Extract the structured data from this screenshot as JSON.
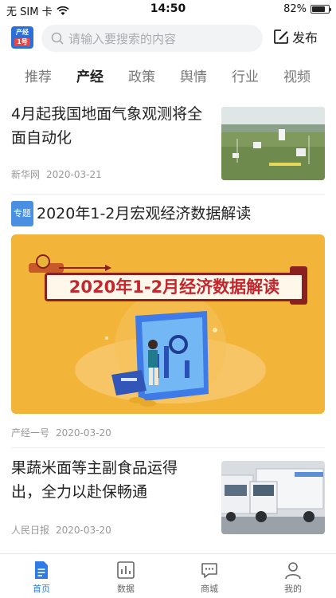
{
  "status_bar": {
    "carrier": "无 SIM 卡",
    "time": "14:50",
    "battery": "82%",
    "battery_level": 0.82
  },
  "header": {
    "logo_top": "产经",
    "logo_bottom": "1号",
    "search_placeholder": "请输入要搜索的内容",
    "publish_label": "发布"
  },
  "tabs": [
    {
      "label": "推荐",
      "active": false
    },
    {
      "label": "产经",
      "active": true
    },
    {
      "label": "政策",
      "active": false
    },
    {
      "label": "舆情",
      "active": false
    },
    {
      "label": "行业",
      "active": false
    },
    {
      "label": "视频",
      "active": false
    }
  ],
  "feed": [
    {
      "title": "4月起我国地面气象观测将全面自动化",
      "source": "新华网",
      "date": "2020-03-21"
    },
    {
      "badge": "专题",
      "title": "2020年1-2月宏观经济数据解读",
      "banner_text": "2020年1-2月经济数据解读",
      "source": "产经一号",
      "date": "2020-03-20"
    },
    {
      "title": "果蔬米面等主副食品运得出，全力以赴保畅通",
      "source": "人民日报",
      "date": "2020-03-20"
    }
  ],
  "bottom_nav": [
    {
      "label": "首页",
      "icon": "home-doc-icon",
      "active": true
    },
    {
      "label": "数据",
      "icon": "chart-icon",
      "active": false
    },
    {
      "label": "商城",
      "icon": "chat-icon",
      "active": false
    },
    {
      "label": "我的",
      "icon": "user-icon",
      "active": false
    }
  ],
  "colors": {
    "accent": "#2f7be5",
    "banner_bg": "#f3b43a",
    "banner_text": "#c4262e"
  }
}
